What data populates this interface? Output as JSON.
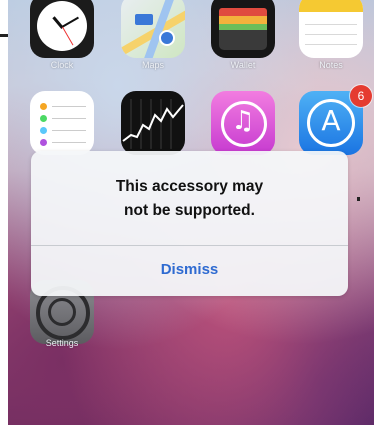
{
  "apps": {
    "clock": "Clock",
    "maps": "Maps",
    "wallet": "Wallet",
    "notes": "Notes",
    "settings": "Settings"
  },
  "badges": {
    "app_store": "6"
  },
  "alert": {
    "message": "This accessory may\nnot be supported.",
    "dismiss_label": "Dismiss"
  },
  "colors": {
    "alert_button": "#2f6bd1",
    "badge": "#e53b30"
  }
}
